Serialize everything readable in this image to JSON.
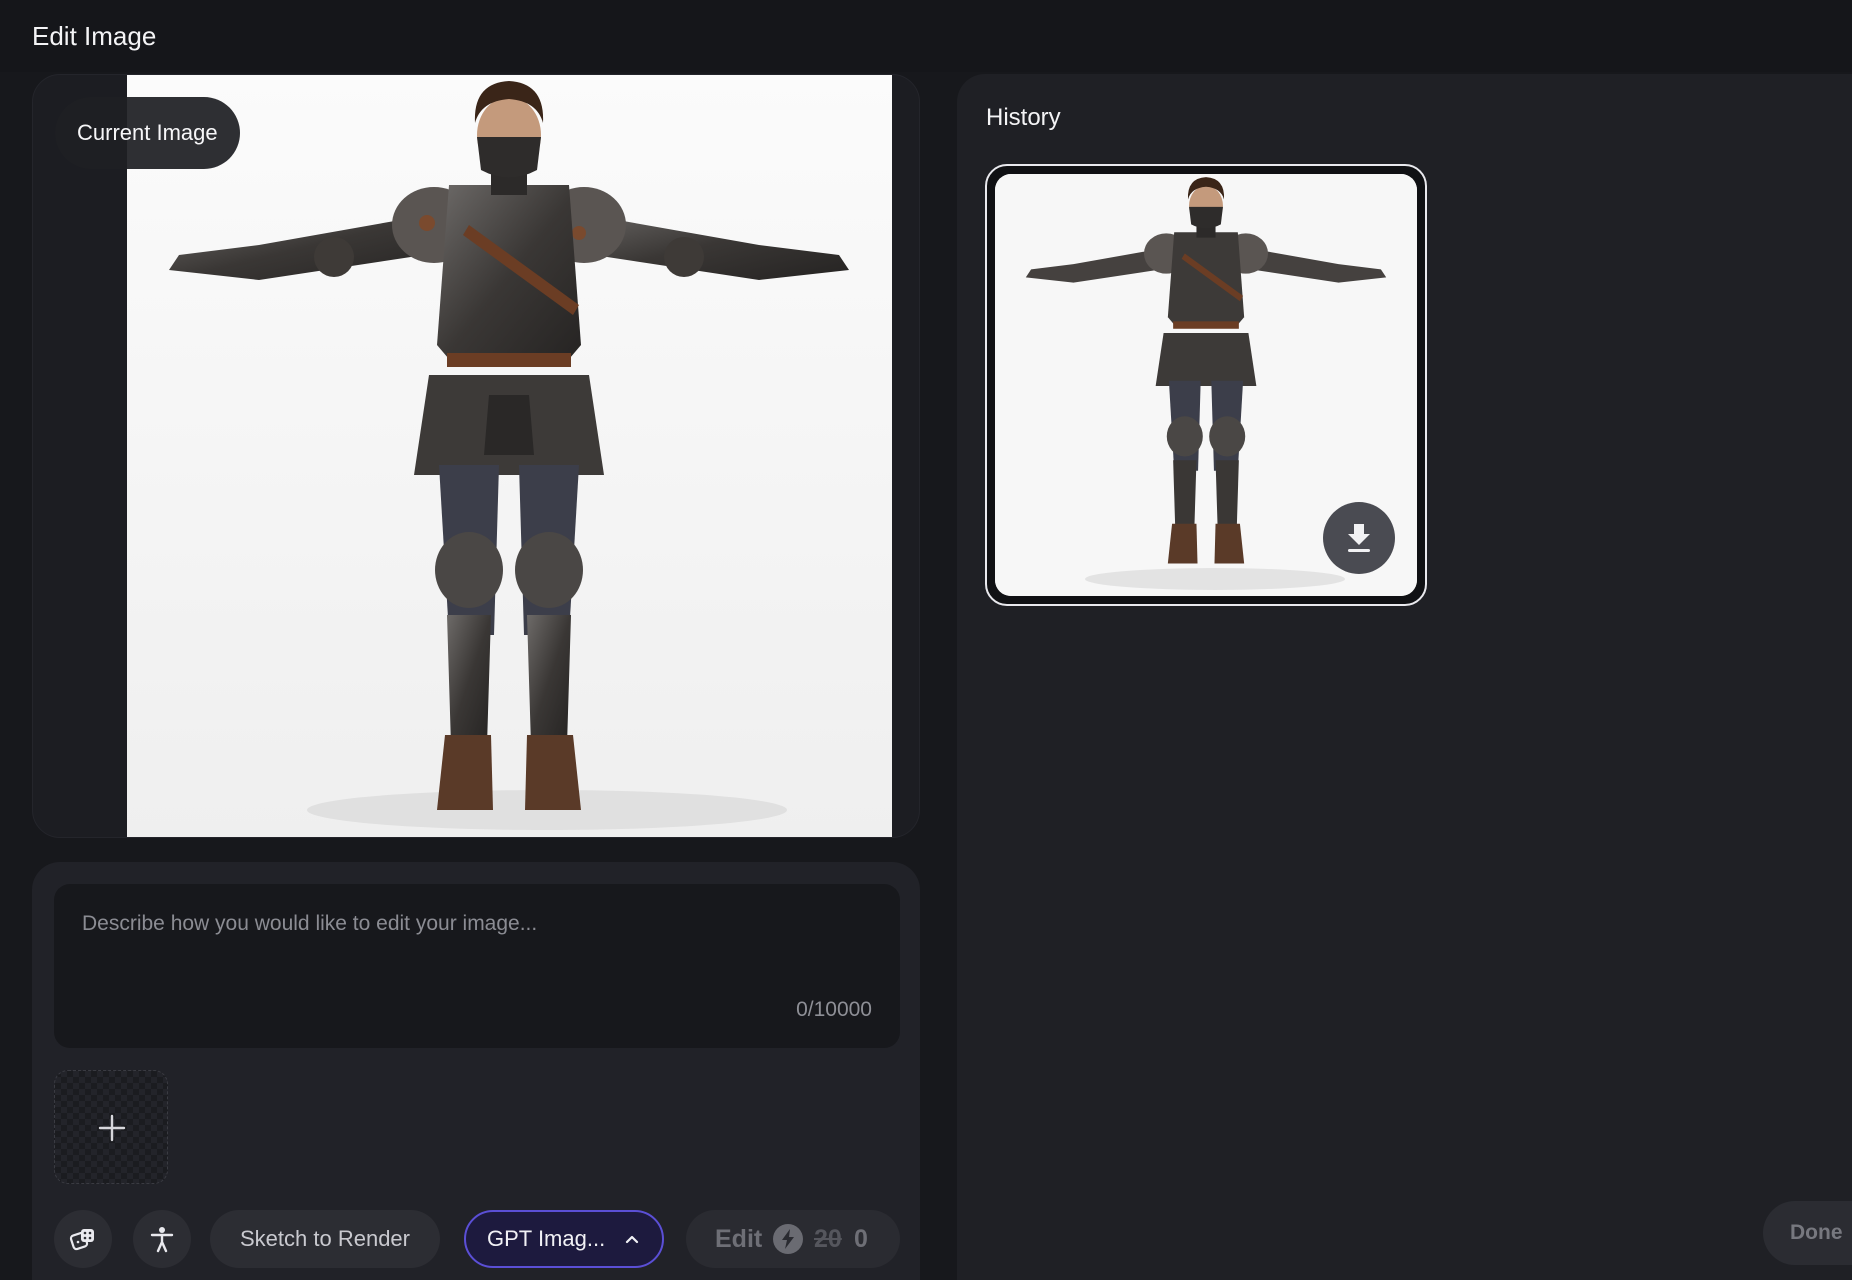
{
  "header": {
    "title": "Edit Image"
  },
  "current_image": {
    "badge": "Current Image"
  },
  "prompt": {
    "placeholder": "Describe how you would like to edit your image...",
    "value": "",
    "counter": "0/10000"
  },
  "toolbar": {
    "sketch_label": "Sketch to Render",
    "model_label": "GPT Imag...",
    "edit_label": "Edit",
    "edit_cost_original": "20",
    "edit_cost_current": "0"
  },
  "history": {
    "title": "History"
  },
  "footer": {
    "done_label": "Done"
  },
  "icons": {
    "dice": "dice-icon",
    "pose": "person-pose-icon",
    "add": "plus-icon",
    "chevron": "chevron-up-icon",
    "bolt": "lightning-icon",
    "download": "download-icon"
  },
  "colors": {
    "background": "#17181c",
    "panel": "#1f2025",
    "model_accent": "#5b4fd6",
    "model_bg": "#1d1a3e"
  }
}
